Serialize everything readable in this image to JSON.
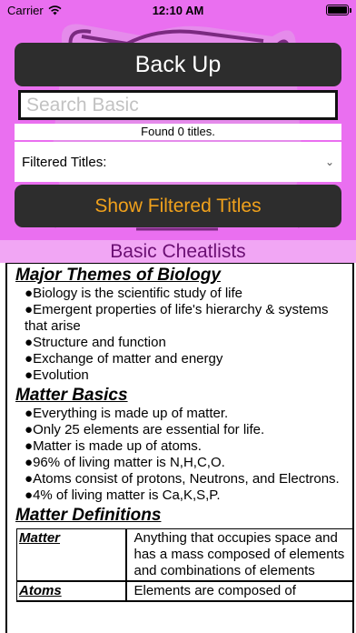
{
  "status_bar": {
    "carrier": "Carrier",
    "time": "12:10 AM"
  },
  "back_button": {
    "label": "Back Up"
  },
  "search": {
    "placeholder": "Search Basic",
    "value": ""
  },
  "found_text": "Found 0 titles.",
  "filter": {
    "label": "Filtered Titles:"
  },
  "show_button": {
    "label": "Show Filtered Titles"
  },
  "section": {
    "title": "Basic Cheatlists"
  },
  "content": {
    "sections": [
      {
        "heading": "Major Themes of Biology",
        "items": [
          "Biology is the scientific study of life",
          "Emergent properties of life's hierarchy & systems that arise",
          "Structure and function",
          "Exchange of matter and energy",
          "Evolution"
        ]
      },
      {
        "heading": "Matter Basics",
        "items": [
          "Everything is made up of matter.",
          "Only 25 elements are essential for life.",
          "Matter is made up of atoms.",
          "96% of living matter is N,H,C,O.",
          "Atoms consist of protons, Neutrons, and Electrons.",
          "4% of living matter is Ca,K,S,P."
        ]
      }
    ],
    "definitions": {
      "heading": "Matter Definitions",
      "rows": [
        {
          "term": "Matter",
          "definition": "Anything that occupies space and has a mass composed of elements and combinations of elements"
        },
        {
          "term": "Atoms",
          "definition": "Elements are composed of"
        }
      ]
    }
  },
  "colors": {
    "background_pink": "#ea6ff0",
    "header_pink": "#f1a6f4",
    "header_text": "#6b0f73",
    "button_dark": "#2d2d2d",
    "show_button_text": "#f0a11c"
  },
  "icons": [
    "wifi-icon",
    "battery-icon",
    "chevron-down-icon"
  ]
}
